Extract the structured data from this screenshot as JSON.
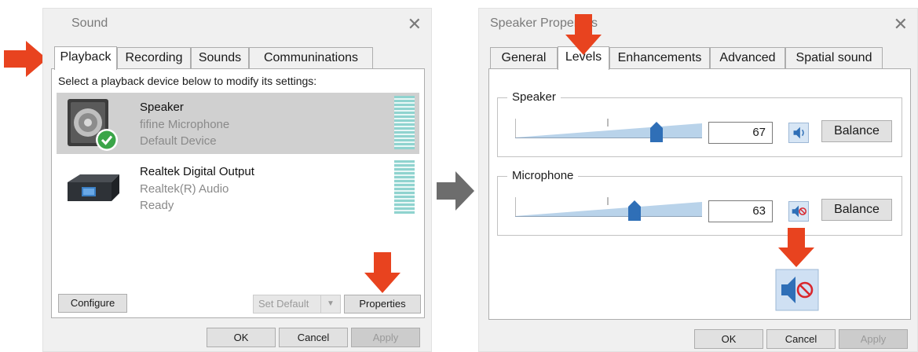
{
  "sound_window": {
    "title": "Sound",
    "tabs": [
      "Playback",
      "Recording",
      "Sounds",
      "Communinations"
    ],
    "instruction": "Select a playback device below to modify its settings:",
    "devices": [
      {
        "name": "Speaker",
        "line1": "fifine Microphone",
        "line2": "Default Device",
        "selected": true,
        "icon": "speaker-device-icon"
      },
      {
        "name": "Realtek Digital Output",
        "line1": "Realtek(R) Audio",
        "line2": "Ready",
        "selected": false,
        "icon": "digital-output-device-icon"
      }
    ],
    "buttons": {
      "configure": "Configure",
      "set_default": "Set Default",
      "properties": "Properties"
    },
    "footer": {
      "ok": "OK",
      "cancel": "Cancel",
      "apply": "Apply"
    }
  },
  "speaker_properties": {
    "title": "Speaker Properties",
    "tabs": [
      "General",
      "Levels",
      "Enhancements",
      "Advanced",
      "Spatial sound"
    ],
    "active_tab": "Levels",
    "levels": [
      {
        "label": "Speaker",
        "value": "67",
        "muted": false,
        "balance": "Balance"
      },
      {
        "label": "Microphone",
        "value": "63",
        "muted": true,
        "balance": "Balance"
      }
    ],
    "footer": {
      "ok": "OK",
      "cancel": "Cancel",
      "apply": "Apply"
    }
  },
  "colors": {
    "arrow_red": "#e8431f",
    "arrow_gray": "#6d6d6d",
    "mute_blue": "#2f6fb7",
    "mute_red": "#d9262c"
  },
  "icons": [
    "red-arrow-icon",
    "gray-arrow-icon",
    "speaker-mute-icon",
    "speaker-unmuted-icon",
    "check-icon",
    "close-icon"
  ]
}
